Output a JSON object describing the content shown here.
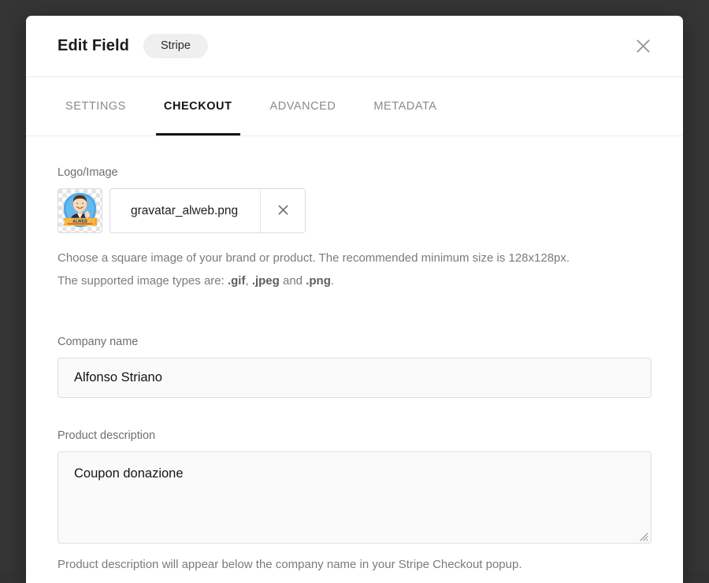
{
  "modal": {
    "title": "Edit Field",
    "badge": "Stripe",
    "close_label": "Close",
    "close_icon": "close-icon"
  },
  "tabs": [
    {
      "label": "SETTINGS",
      "active": false
    },
    {
      "label": "CHECKOUT",
      "active": true
    },
    {
      "label": "ADVANCED",
      "active": false
    },
    {
      "label": "METADATA",
      "active": false
    }
  ],
  "form": {
    "logo": {
      "label": "Logo/Image",
      "file_name": "gravatar_alweb.png",
      "clear_icon": "close-icon",
      "thumbnail_alt": "gravatar alweb avatar",
      "thumbnail_banner_text": "ALWEB",
      "help_line1": "Choose a square image of your brand or product. The recommended minimum size is 128x128px.",
      "help_line2_prefix": "The supported image types are: ",
      "help_types": [
        ".gif",
        ".jpeg",
        ".png"
      ],
      "help_line2_sep": ", ",
      "help_line2_and": " and ",
      "help_line2_end": "."
    },
    "company_name": {
      "label": "Company name",
      "value": "Alfonso Striano",
      "placeholder": "Company name"
    },
    "product_description": {
      "label": "Product description",
      "value": "Coupon donazione",
      "placeholder": "Product description",
      "help": "Product description will appear below the company name in your Stripe Checkout popup."
    }
  },
  "colors": {
    "backdrop": "#353535",
    "surface": "#ffffff",
    "accent": "#141414",
    "muted_text": "#7b7b7b",
    "border": "#dedede",
    "badge_bg": "#efefef",
    "input_bg": "#fafafa"
  }
}
